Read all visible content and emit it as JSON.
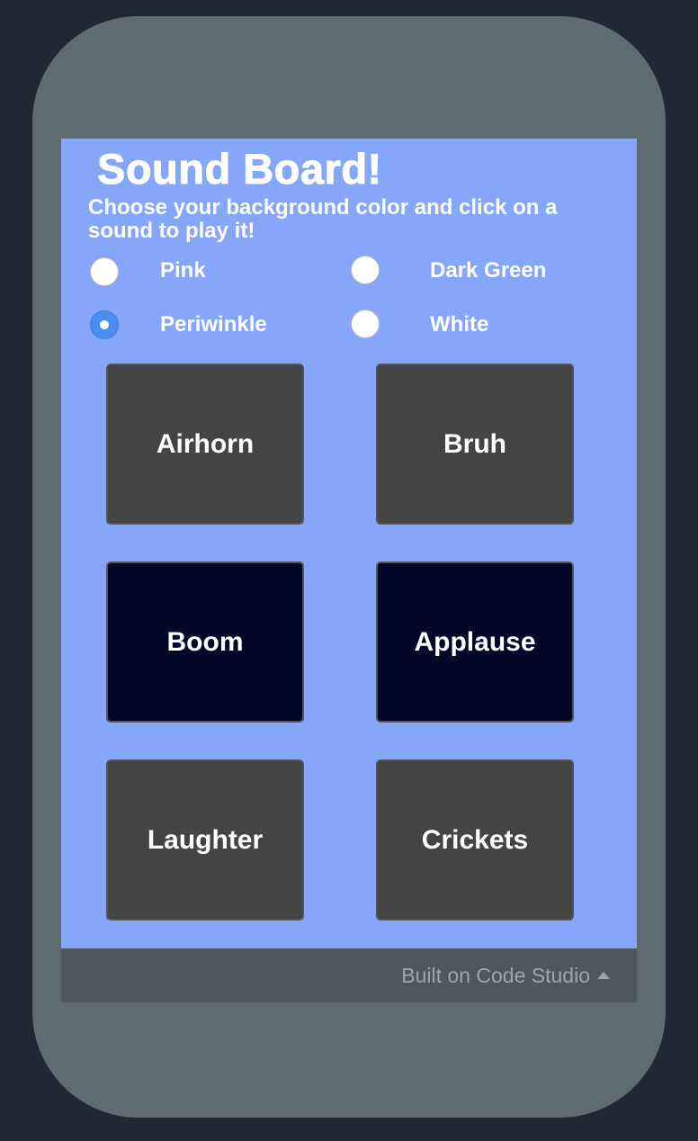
{
  "app": {
    "title": "Sound Board!",
    "subtitle": "Choose your background color and click on a sound to play it!"
  },
  "colors": {
    "outer_background": "#222832",
    "phone_frame": "#5f6a71",
    "screen_background": "#86a7f9",
    "button_gray": "#444444",
    "button_navy": "#040828",
    "radio_selected": "#4a8ff0",
    "footer": "#50575c"
  },
  "color_options": [
    {
      "label": "Pink",
      "selected": false
    },
    {
      "label": "Dark Green",
      "selected": false
    },
    {
      "label": "Periwinkle",
      "selected": true
    },
    {
      "label": "White",
      "selected": false
    }
  ],
  "sounds": [
    {
      "label": "Airhorn",
      "color": "#444444"
    },
    {
      "label": "Bruh",
      "color": "#444444"
    },
    {
      "label": "Boom",
      "color": "#040828"
    },
    {
      "label": "Applause",
      "color": "#040828"
    },
    {
      "label": "Laughter",
      "color": "#444444"
    },
    {
      "label": "Crickets",
      "color": "#444444"
    }
  ],
  "footer": {
    "text": "Built on Code Studio",
    "icon": "caret-up-icon"
  }
}
